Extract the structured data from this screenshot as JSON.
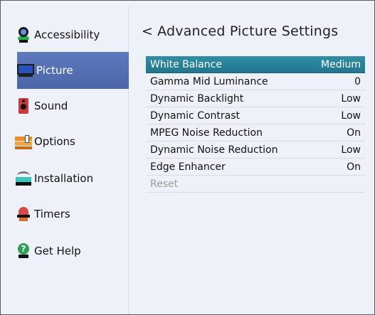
{
  "sidebar": {
    "items": [
      {
        "label": "Accessibility",
        "icon": "accessibility-icon",
        "selected": false
      },
      {
        "label": "Picture",
        "icon": "picture-icon",
        "selected": true
      },
      {
        "label": "Sound",
        "icon": "sound-icon",
        "selected": false
      },
      {
        "label": "Options",
        "icon": "options-icon",
        "selected": false
      },
      {
        "label": "Installation",
        "icon": "installation-icon",
        "selected": false
      },
      {
        "label": "Timers",
        "icon": "timers-icon",
        "selected": false
      },
      {
        "label": "Get Help",
        "icon": "get-help-icon",
        "selected": false
      }
    ]
  },
  "main": {
    "back_glyph": "<",
    "title": "Advanced Picture Settings",
    "rows": [
      {
        "label": "White Balance",
        "value": "Medium",
        "selected": true
      },
      {
        "label": "Gamma Mid Luminance",
        "value": "0"
      },
      {
        "label": "Dynamic Backlight",
        "value": "Low"
      },
      {
        "label": "Dynamic Contrast",
        "value": "Low"
      },
      {
        "label": "MPEG Noise Reduction",
        "value": "On"
      },
      {
        "label": "Dynamic Noise Reduction",
        "value": "Low"
      },
      {
        "label": "Edge Enhancer",
        "value": "On"
      },
      {
        "label": "Reset",
        "value": "",
        "disabled": true
      }
    ]
  },
  "colors": {
    "sidebar_selected": "#4f68aa",
    "row_selected": "#2a85a0",
    "background": "#eef2f8"
  }
}
